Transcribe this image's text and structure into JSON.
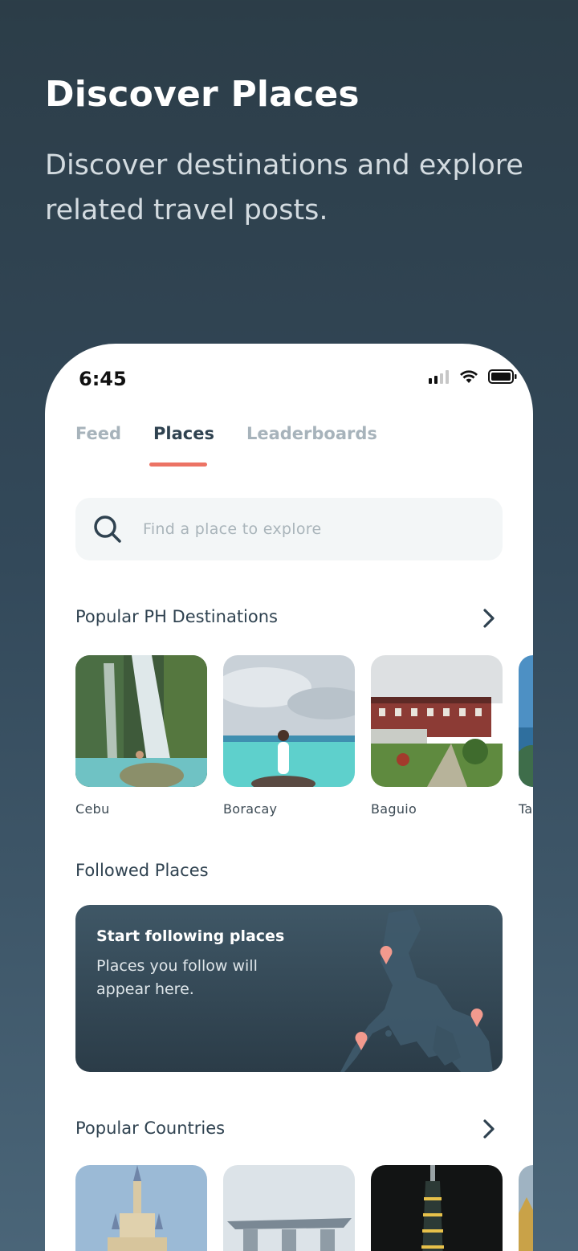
{
  "hero": {
    "title": "Discover Places",
    "subtitle": "Discover destinations and explore related travel posts."
  },
  "status_bar": {
    "time": "6:45",
    "icons": [
      "cellular-signal-icon",
      "wifi-icon",
      "battery-icon"
    ]
  },
  "tabs": [
    {
      "label": "Feed",
      "active": false
    },
    {
      "label": "Places",
      "active": true
    },
    {
      "label": "Leaderboards",
      "active": false
    }
  ],
  "search": {
    "placeholder": "Find a place to explore",
    "icon": "search-icon"
  },
  "popular_ph": {
    "title": "Popular PH Destinations",
    "items": [
      {
        "label": "Cebu"
      },
      {
        "label": "Boracay"
      },
      {
        "label": "Baguio"
      },
      {
        "label": "Ta"
      }
    ]
  },
  "followed": {
    "title": "Followed Places",
    "card_title": "Start following places",
    "card_text": "Places you follow will appear here."
  },
  "popular_countries": {
    "title": "Popular Countries"
  },
  "colors": {
    "accent": "#ec7364",
    "dark": "#2f4250",
    "muted": "#a7b3bb"
  }
}
